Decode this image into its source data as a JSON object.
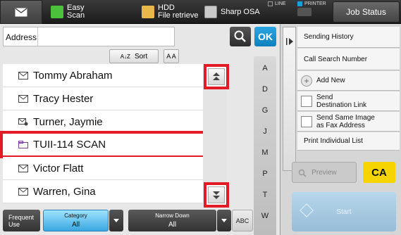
{
  "topbar": {
    "easy_scan_label": "Easy\nScan",
    "hdd_label": "HDD\nFile retrieve",
    "sharp_osa_label": "Sharp OSA",
    "line_label": "LINE",
    "printer_label": "PRINTER",
    "job_status_label": "Job Status"
  },
  "address": {
    "label": "Address",
    "value": ""
  },
  "ok_label": "OK",
  "sort": {
    "label": "Sort"
  },
  "contacts": [
    {
      "name": "Tommy Abraham",
      "icon": "mail-icon"
    },
    {
      "name": "Tracy Hester",
      "icon": "mail-icon"
    },
    {
      "name": "Turner, Jaymie",
      "icon": "group-mail-icon"
    },
    {
      "name": "TUII-114 SCAN",
      "icon": "folder-icon"
    },
    {
      "name": "Victor Flatt",
      "icon": "mail-icon"
    },
    {
      "name": "Warren, Gina",
      "icon": "mail-icon"
    }
  ],
  "alphabet": [
    "A",
    "D",
    "G",
    "J",
    "M",
    "P",
    "T",
    "W"
  ],
  "bottombar": {
    "frequent_use": "Frequent\nUse",
    "category_label": "Category",
    "category_value": "All",
    "narrow_down_label": "Narrow Down",
    "narrow_down_value": "All",
    "abc_label": "ABC"
  },
  "right_panel": {
    "sending_history": "Sending History",
    "call_search_number": "Call Search Number",
    "add_new": "Add New",
    "send_destination_link": "Send\nDestination Link",
    "send_same_image": "Send Same Image\nas Fax Address",
    "print_individual_list": "Print Individual List",
    "preview": "Preview",
    "ca": "CA",
    "start": "Start"
  },
  "colors": {
    "accent_blue": "#18a1d8",
    "highlight_red": "#e21b24",
    "ca_yellow": "#f5d400"
  }
}
